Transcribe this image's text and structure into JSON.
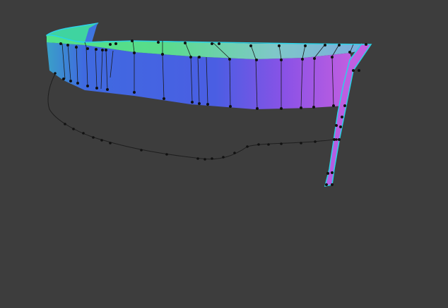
{
  "viewport": {
    "background": "#3d3d3d",
    "mode": "3D edit view",
    "mesh": {
      "gradient": [
        "#3fe08a",
        "#4a9fd6",
        "#3f5fe0",
        "#8f4fe6",
        "#c85fe0"
      ],
      "outline_color": "#29d2e6",
      "edge_color": "#1a1a1a",
      "vertex_color": "#111111"
    },
    "curve_color": "#1e1e1e"
  }
}
